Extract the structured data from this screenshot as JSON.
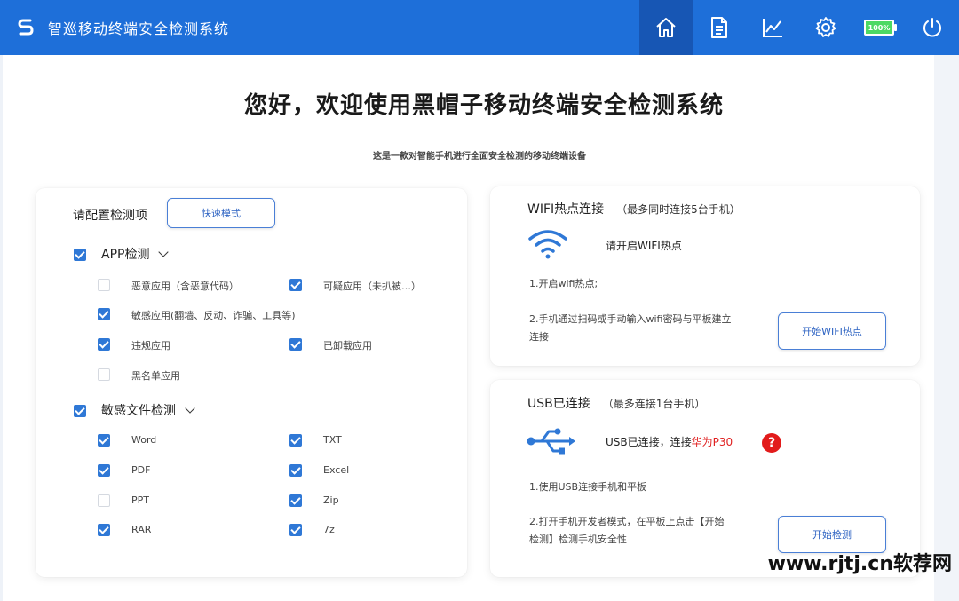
{
  "app": {
    "title": "智巡移动终端安全检测系统"
  },
  "toolbar": {
    "items": [
      {
        "name": "home-icon",
        "active": true
      },
      {
        "name": "document-icon",
        "active": false
      },
      {
        "name": "chart-icon",
        "active": false
      },
      {
        "name": "gear-icon",
        "active": false
      },
      {
        "name": "battery-icon",
        "active": false
      },
      {
        "name": "power-icon",
        "active": false
      }
    ],
    "battery_label": "100%"
  },
  "main": {
    "title": "您好，欢迎使用黑帽子移动终端安全检测系统",
    "subtitle": "这是一款对智能手机进行全面安全检测的移动终端设备"
  },
  "config": {
    "title": "请配置检测项",
    "quick_mode_label": "快速模式",
    "app_section": {
      "label": "APP检测",
      "checked": true,
      "items": [
        {
          "label": "恶意应用（含恶意代码）",
          "checked": false
        },
        {
          "label": "可疑应用（未扒被…）",
          "checked": true
        },
        {
          "label": "敏感应用(翻墙、反动、诈骗、工具等)",
          "checked": true
        },
        {
          "label": "违规应用",
          "checked": true
        },
        {
          "label": "已卸载应用",
          "checked": true
        },
        {
          "label": "黑名单应用",
          "checked": false
        }
      ]
    },
    "file_section": {
      "label": "敏感文件检测",
      "checked": true,
      "items": [
        {
          "label": "Word",
          "checked": true
        },
        {
          "label": "TXT",
          "checked": true
        },
        {
          "label": "PDF",
          "checked": true
        },
        {
          "label": "Excel",
          "checked": true
        },
        {
          "label": "PPT",
          "checked": false
        },
        {
          "label": "Zip",
          "checked": true
        },
        {
          "label": "RAR",
          "checked": true
        },
        {
          "label": "7z",
          "checked": true
        }
      ]
    }
  },
  "wifi": {
    "title": "WIFI热点连接",
    "note": "（最多同时连接5台手机）",
    "status": "请开启WIFI热点",
    "step1": "1.开启wifi热点;",
    "step2_line1": "2.手机通过扫码或手动输入wifi密码与平板建立",
    "step2_line2": "连接",
    "button_label": "开始WIFI热点"
  },
  "usb": {
    "title": "USB已连接",
    "note": "（最多连接1台手机）",
    "status_prefix": "USB已连接，连接",
    "device": "华为P30",
    "step1": "1.使用USB连接手机和平板",
    "step2_line1": "2.打开手机开发者模式，在平板上点击【开始",
    "step2_line2": "检测】检测手机安全性",
    "button_label": "开始检测"
  },
  "watermark": "www.rjtj.cn软荐网",
  "colors": {
    "topbar": "#1e6fd9",
    "active_tab": "#1756b4",
    "accent": "#2f78d6",
    "alert": "#e21b1b"
  }
}
